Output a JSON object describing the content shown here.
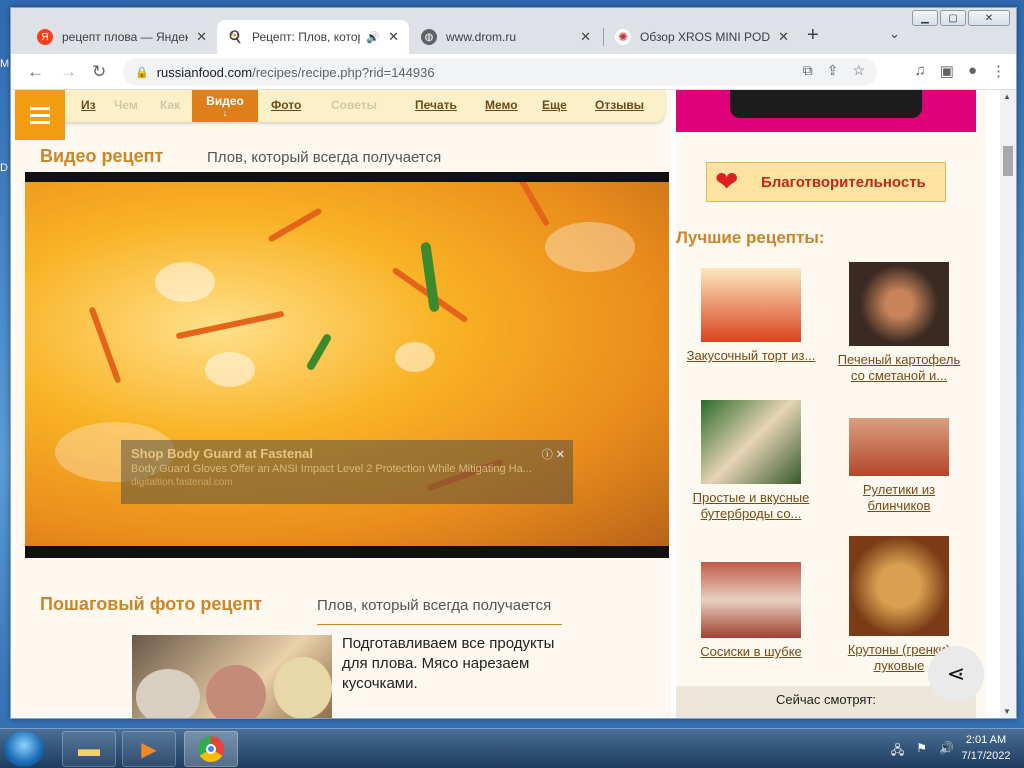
{
  "browser": {
    "tabs": [
      {
        "title": "рецепт плова — Яндекс",
        "favicon": "Я"
      },
      {
        "title": "Рецепт: Плов, который",
        "favicon": ""
      },
      {
        "title": "www.drom.ru",
        "favicon": ""
      },
      {
        "title": "Обзор XROS MINI POD",
        "favicon": ""
      }
    ],
    "url_host": "russianfood.com",
    "url_path": "/recipes/recipe.php?rid=144936"
  },
  "page": {
    "nav": [
      {
        "label": "Из",
        "dim": false
      },
      {
        "label": "Чем",
        "dim": true
      },
      {
        "label": "Как",
        "dim": true
      },
      {
        "label": "Видео",
        "dim": false
      },
      {
        "label": "Фото",
        "dim": false
      },
      {
        "label": "Советы",
        "dim": true
      },
      {
        "label": "Печать",
        "dim": false
      },
      {
        "label": "Мемо",
        "dim": false
      },
      {
        "label": "Еще",
        "dim": false
      },
      {
        "label": "Отзывы",
        "dim": false
      }
    ],
    "video_section": {
      "title": "Видео рецепт",
      "subtitle": "Плов, который всегда получается"
    },
    "ad": {
      "headline": "Shop Body Guard at Fastenal",
      "desc": "Body Guard Gloves Offer an ANSI Impact Level 2 Protection While Mitigating Ha...",
      "source": "digitaltion.fastenal.com"
    },
    "photo_section": {
      "title": "Пошаговый фото рецепт",
      "subtitle": "Плов, который всегда получается"
    },
    "step_text": "Подготавливаем все продукты для плова. Мясо нарезаем кусочками."
  },
  "sidebar": {
    "charity": "Благотворительность",
    "best_title": "Лучшие рецепты:",
    "recipes": [
      {
        "caption": "Закусочный торт из..."
      },
      {
        "caption": "Печеный картофель со сметаной и..."
      },
      {
        "caption": "Простые и вкусные бутерброды со..."
      },
      {
        "caption": "Рулетики из блинчиков"
      },
      {
        "caption": "Сосиски в шубке"
      },
      {
        "caption": "Крутоны (гренки) луковые"
      }
    ],
    "now_watching": "Сейчас смотрят:"
  },
  "taskbar": {
    "time": "2:01 AM",
    "date": "7/17/2022"
  },
  "colors": {
    "accent": "#f39c12",
    "title_brown": "#c9862a",
    "charity_red": "#c02a1a"
  }
}
